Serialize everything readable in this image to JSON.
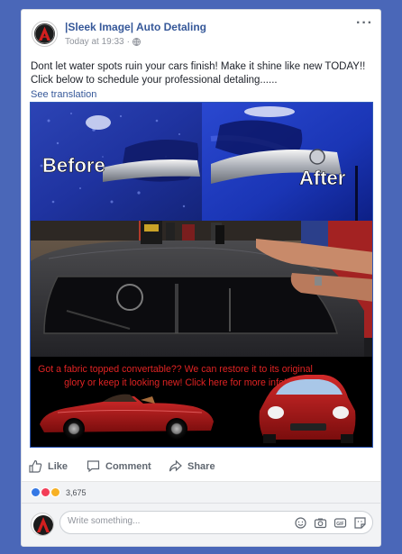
{
  "post": {
    "page_name": "|Sleek Image| Auto Detaling",
    "timestamp": "Today at 19:33",
    "separator": "·",
    "text": "Dont let water spots ruin your cars finish! Make it shine like new TODAY!! Click below to schedule your professional detaling......",
    "see_translation": "See translation",
    "more_icon": "···"
  },
  "media": {
    "before_label": "Before",
    "after_label": "After",
    "promo_text": "Got a fabric topped convertable?? We can restore it to its original glory or keep it looking new! Click here for more info!"
  },
  "actions": {
    "like": "Like",
    "comment": "Comment",
    "share": "Share"
  },
  "reactions": {
    "count": "3,675",
    "types": [
      "like",
      "love",
      "wow"
    ]
  },
  "comment_box": {
    "placeholder": "Write something..."
  },
  "icons": [
    "ellipsis-icon",
    "globe-icon",
    "like-icon",
    "comment-icon",
    "share-icon",
    "emoji-icon",
    "camera-icon",
    "gif-icon",
    "sticker-icon"
  ],
  "colors": {
    "page_background": "#4a67b8",
    "link": "#365899",
    "promo_text": "#e02323"
  }
}
